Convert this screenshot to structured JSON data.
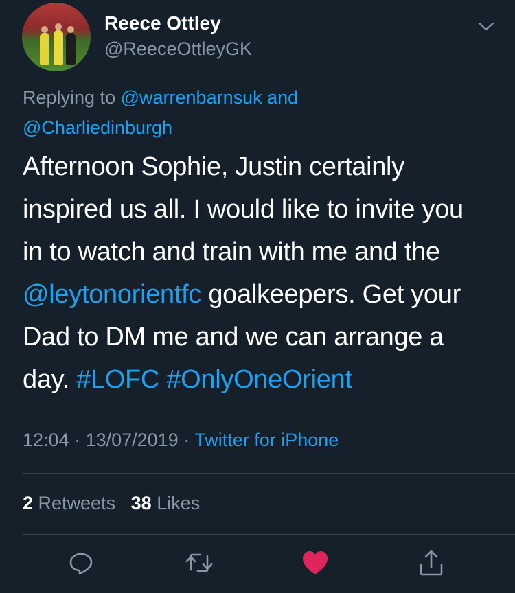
{
  "author": {
    "name": "Reece Ottley",
    "handle": "@ReeceOttleyGK"
  },
  "reply": {
    "prefix": "Replying to",
    "user1": "@warrenbarnsuk",
    "joiner": "and",
    "user2": "@Charliedinburgh"
  },
  "body": {
    "line1": "Afternoon Sophie, Justin certainly",
    "line2": "inspired us all. I would like to invite you",
    "line3": "in to watch and train with me and the",
    "mention": "@leytonorientfc",
    "line4_rest": " goalkeepers. Get your",
    "line5": "Dad to DM me and we can arrange a",
    "line6_start": "day. ",
    "hashtag1": "#LOFC",
    "hashtag2": "#OnlyOneOrient"
  },
  "meta": {
    "time": "12:04",
    "sep1": " · ",
    "date": "13/07/2019",
    "sep2": " · ",
    "source": "Twitter for iPhone"
  },
  "stats": {
    "retweets_count": "2",
    "retweets_label": "Retweets",
    "likes_count": "38",
    "likes_label": "Likes"
  },
  "colors": {
    "background": "#15202b",
    "link": "#1da1f2",
    "muted": "#8899a6",
    "like_active": "#e0245e",
    "divider": "#38444d"
  },
  "icons": {
    "menu": "chevron-down-icon",
    "reply": "reply-icon",
    "retweet": "retweet-icon",
    "like": "heart-icon",
    "share": "share-icon"
  }
}
